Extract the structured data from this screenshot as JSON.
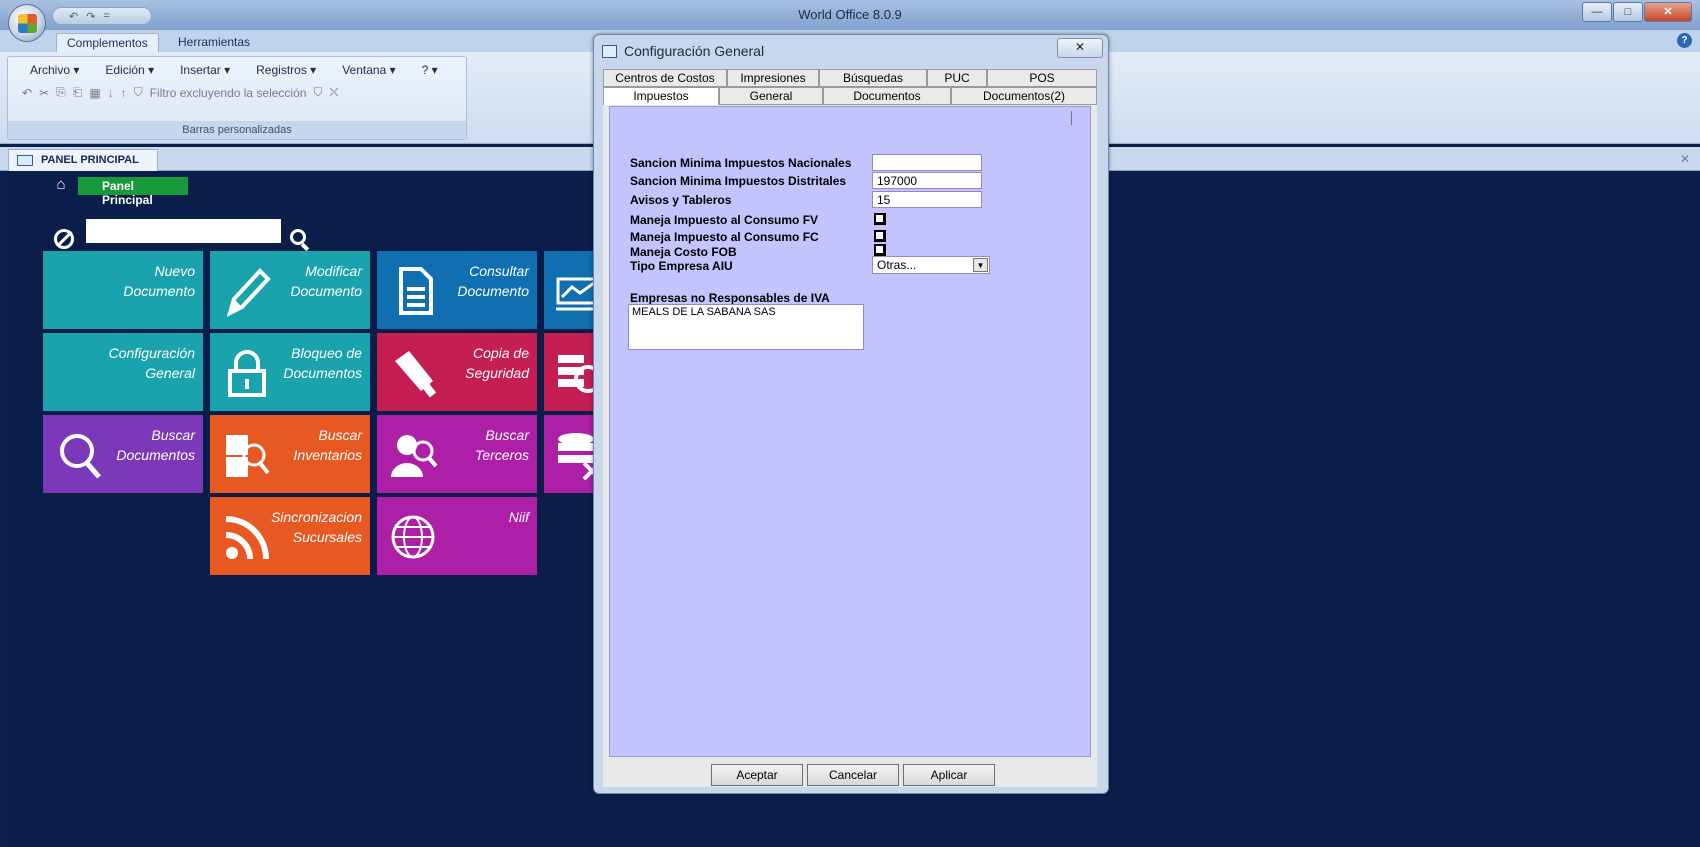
{
  "window": {
    "title": "World Office 8.0.9",
    "qat": [
      "↶",
      "↷",
      "="
    ],
    "controls": [
      "—",
      "□",
      "✕"
    ]
  },
  "ribbon": {
    "tabs": [
      "Complementos",
      "Herramientas"
    ],
    "menus": [
      "Archivo ▾",
      "Edición ▾",
      "Insertar ▾",
      "Registros ▾",
      "Ventana ▾",
      "? ▾"
    ],
    "tools": [
      "↶",
      "✂",
      "⎘",
      "⎗",
      "▦",
      "↓",
      "↑",
      "⛉"
    ],
    "filter_label": "Filtro excluyendo la selección",
    "filter_tools": [
      "⛉",
      "⛌"
    ],
    "group_label": "Barras personalizadas",
    "help": "?"
  },
  "panel": {
    "tab_label": "PANEL PRINCIPAL",
    "close": "✕",
    "breadcrumb": "Panel Principal",
    "home": "⌂"
  },
  "tiles": {
    "nuevo": "Nuevo Documento",
    "modificar": "Modificar Documento",
    "consultar": "Consultar Documento",
    "configuracion": "Configuración General",
    "bloqueo": "Bloqueo de Documentos",
    "copia": "Copia de Seguridad",
    "buscar_doc": "Buscar Documentos",
    "buscar_inv": "Buscar Inventarios",
    "buscar_ter": "Buscar Terceros",
    "sincronizacion": "Sincronizacion Sucursales",
    "niif": "Niif"
  },
  "dialog": {
    "title": "Configuración General",
    "close": "✕",
    "tabs_row1": [
      "Centros de Costos",
      "Impresiones",
      "Búsquedas",
      "PUC",
      "POS"
    ],
    "tabs_row2": [
      "Impuestos",
      "General",
      "Documentos",
      "Documentos(2)"
    ],
    "fields": {
      "sancion_nacional": {
        "label": "Sancion Minima Impuestos Nacionales",
        "value": ""
      },
      "sancion_distrital": {
        "label": "Sancion Minima Impuestos Distritales",
        "value": "197000"
      },
      "avisos": {
        "label": "Avisos y Tableros",
        "value": "15"
      },
      "consumo_fv": {
        "label": "Maneja Impuesto al Consumo FV"
      },
      "consumo_fc": {
        "label": "Maneja Impuesto al Consumo FC"
      },
      "costo_fob": {
        "label": "Maneja Costo FOB"
      },
      "tipo_aiu": {
        "label": "Tipo Empresa AIU",
        "value": "Otras..."
      }
    },
    "empresas_label": "Empresas no Responsables de IVA",
    "empresas_value": "MEALS DE LA SABANA SAS",
    "buttons": {
      "aceptar": "Aceptar",
      "cancelar": "Cancelar",
      "aplicar": "Aplicar"
    }
  }
}
